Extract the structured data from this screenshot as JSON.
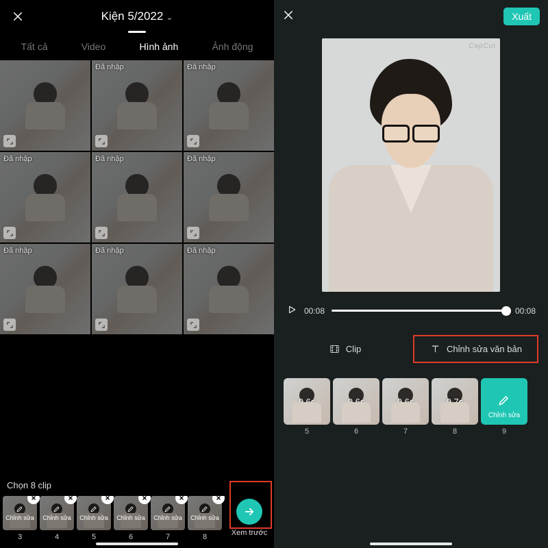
{
  "left": {
    "album_title": "Kiện 5/2022",
    "tabs": [
      "Tất cả",
      "Video",
      "Hình ảnh",
      "Ảnh động"
    ],
    "active_tab_index": 2,
    "grid_badge": "Đã nhập",
    "selection_label": "Chọn 8 clip",
    "tray_edit_label": "Chỉnh sửa",
    "tray_numbers": [
      "3",
      "4",
      "5",
      "6",
      "7",
      "8"
    ],
    "preview_label": "Xem trước"
  },
  "right": {
    "export_label": "Xuất",
    "watermark": "CapCut",
    "time_current": "00:08",
    "time_total": "00:08",
    "tool_clip": "Clip",
    "tool_text": "Chỉnh sửa văn bản",
    "tray": [
      {
        "dur": "0.6s",
        "idx": "5"
      },
      {
        "dur": "0.6s",
        "idx": "6"
      },
      {
        "dur": "0.6s",
        "idx": "7"
      },
      {
        "dur": "0.7s",
        "idx": "8"
      },
      {
        "dur": "",
        "idx": "9",
        "edit": true,
        "edit_label": "Chỉnh sửa"
      }
    ]
  }
}
